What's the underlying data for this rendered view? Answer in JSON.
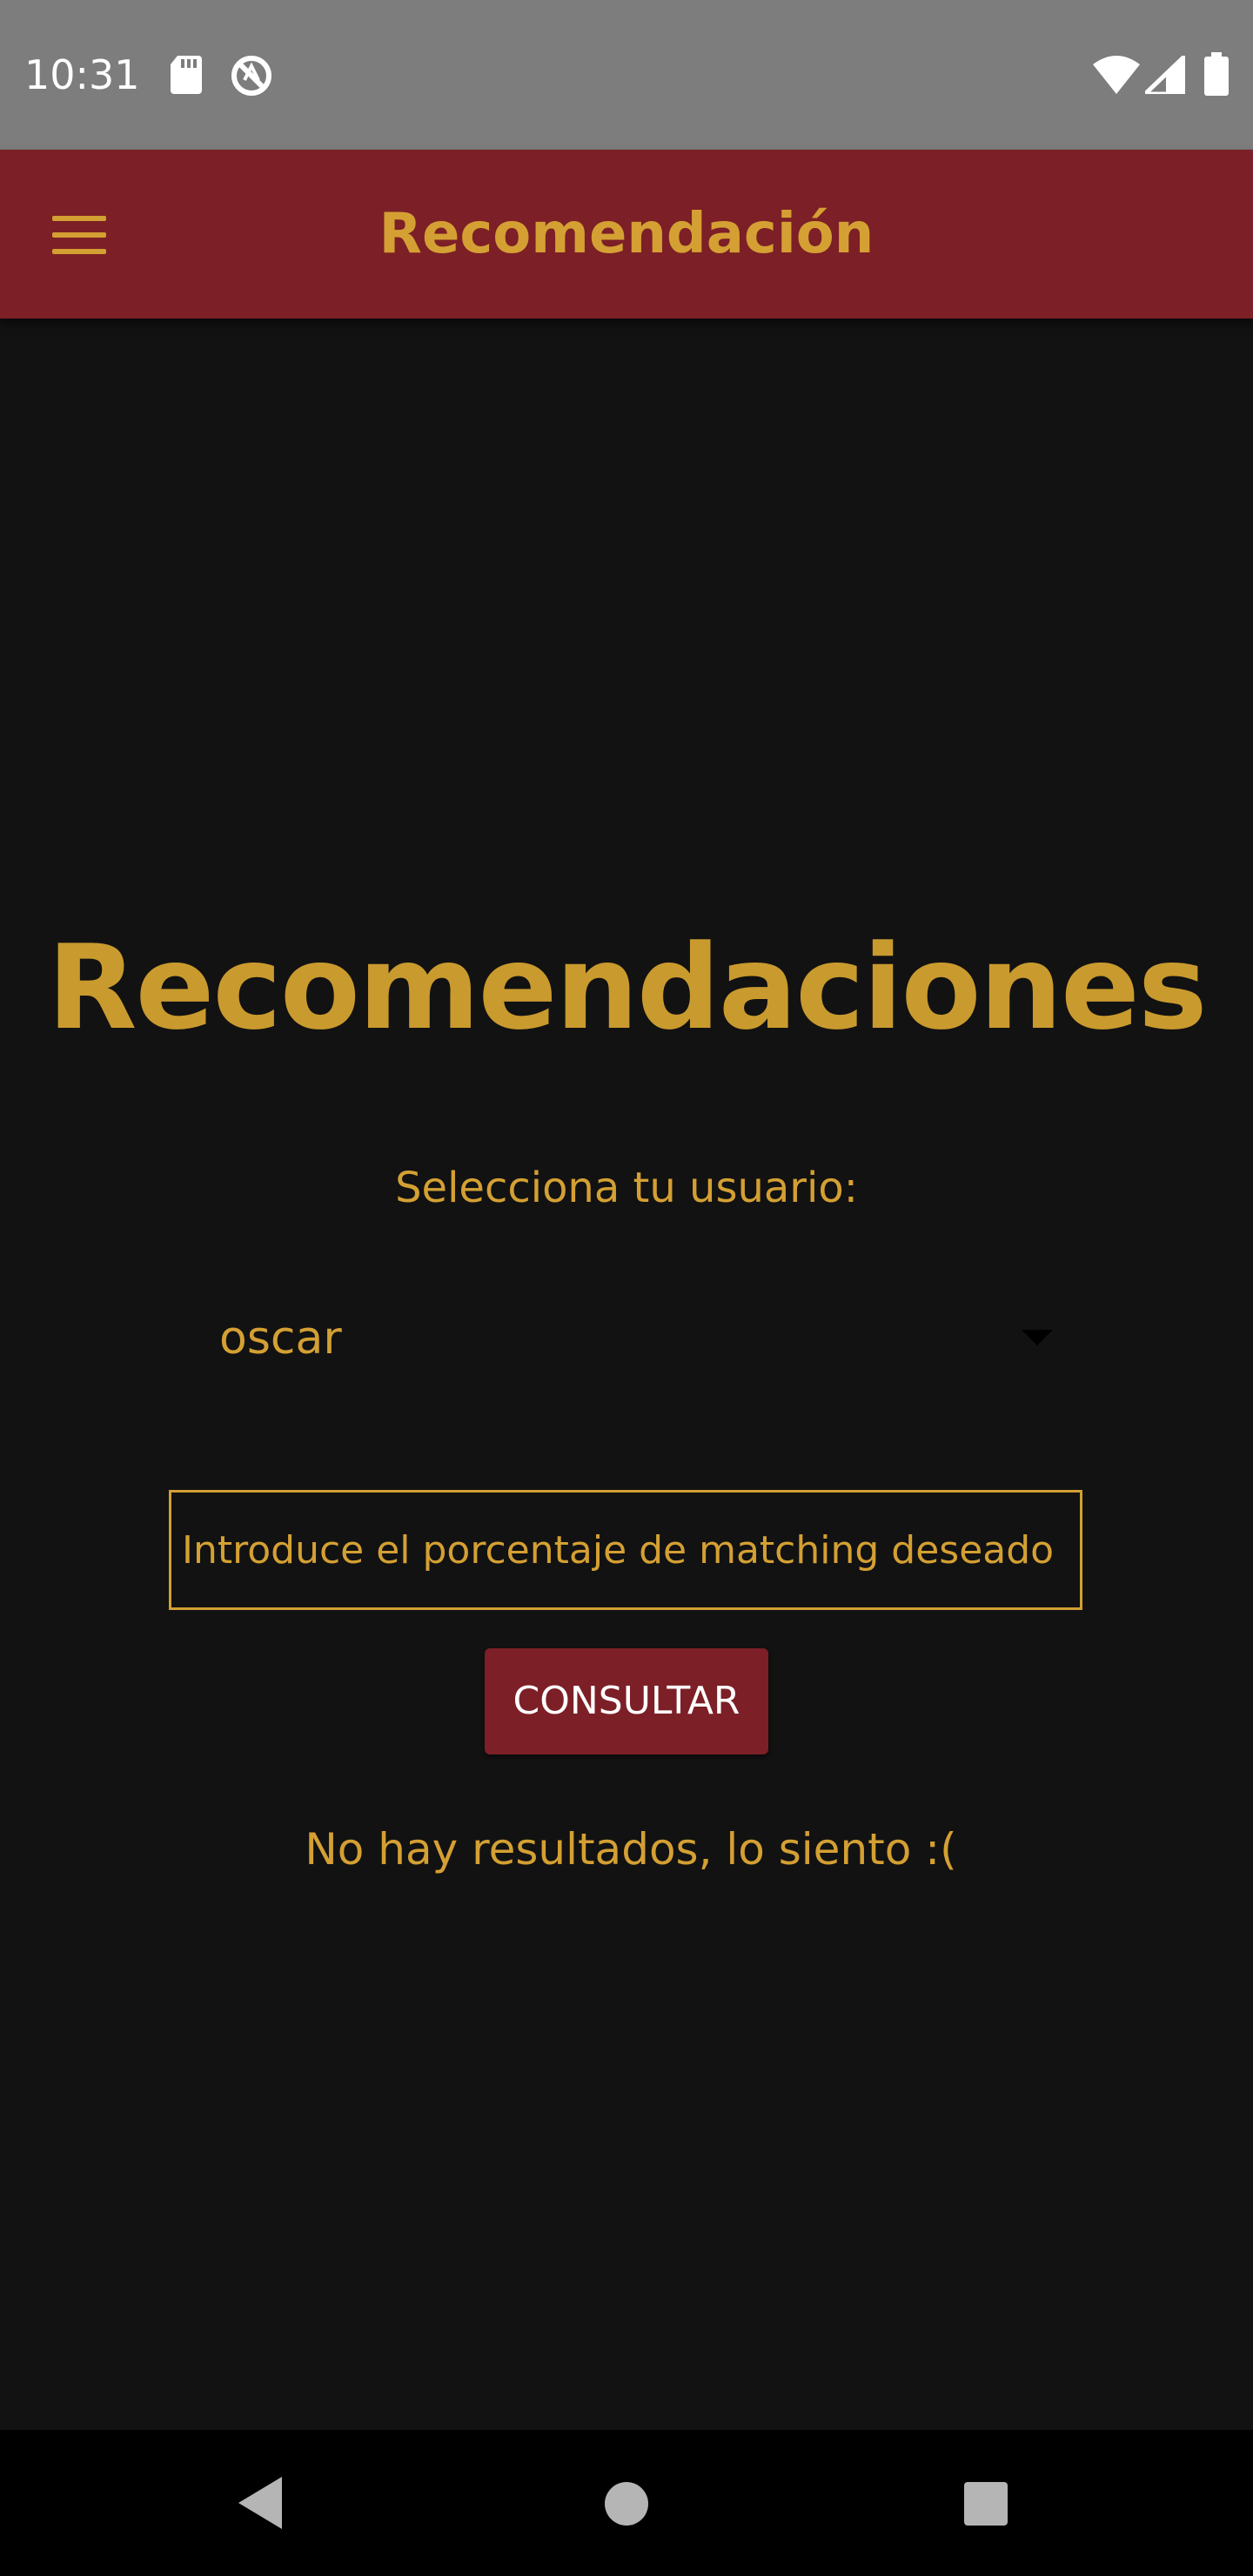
{
  "status_bar": {
    "time": "10:31",
    "left_icons": [
      "sd-card-icon",
      "no-disturb-icon"
    ],
    "right_icons": [
      "wifi-icon",
      "signal-icon",
      "battery-icon"
    ]
  },
  "app_bar": {
    "title": "Recomendación",
    "menu_icon": "hamburger-menu-icon"
  },
  "main": {
    "heading": "Recomendaciones",
    "select_label": "Selecciona tu usuario:",
    "selected_user": "oscar",
    "match_input_placeholder": "Introduce el porcentaje de matching deseado",
    "match_input_value": "",
    "consult_button_label": "CONSULTAR",
    "result_message": "No hay resultados, lo siento :("
  },
  "nav_bar": {
    "icons": [
      "back-icon",
      "home-icon",
      "recents-icon"
    ]
  },
  "colors": {
    "app_bar": "#7c1f26",
    "accent": "#d4a033",
    "background": "#121212",
    "status_bar": "#7d7d7d"
  }
}
